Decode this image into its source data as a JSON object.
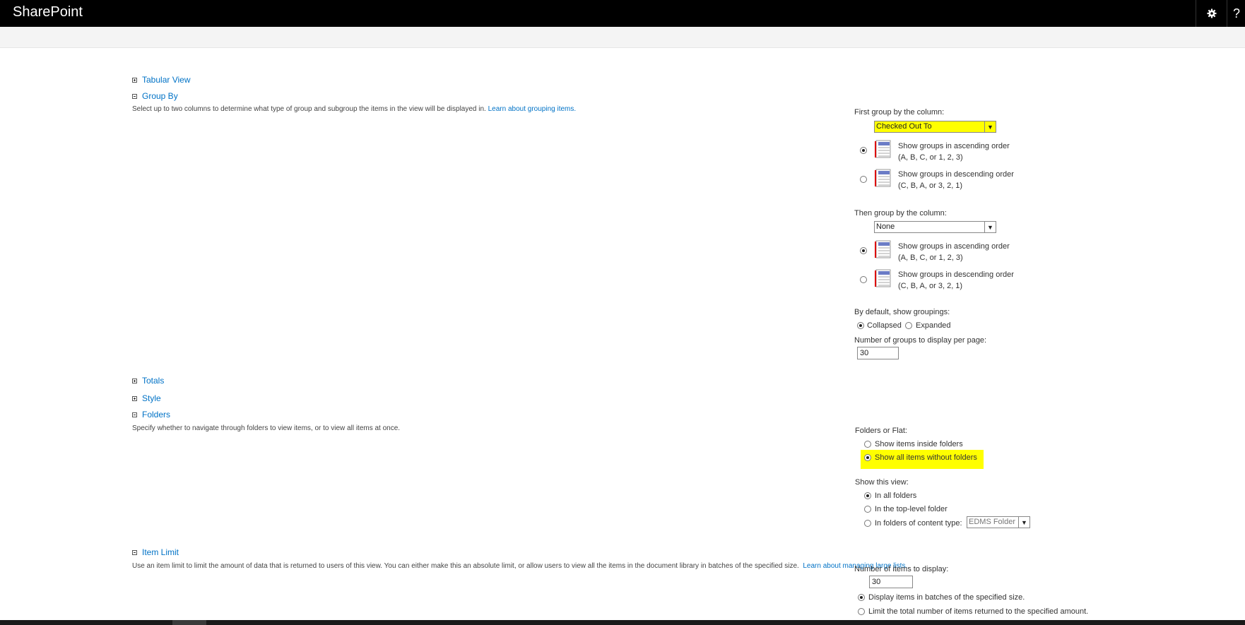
{
  "app": {
    "title": "SharePoint",
    "settings_icon": "gear-icon",
    "help_label": "?"
  },
  "sections": {
    "tabular_view": "Tabular View",
    "group_by": "Group By",
    "group_by_desc": "Select up to two columns to determine what type of group and subgroup the items in the view will be displayed in.",
    "group_by_link": "Learn about grouping items.",
    "totals": "Totals",
    "style": "Style",
    "folders": "Folders",
    "folders_desc": "Specify whether to navigate through folders to view items, or to view all items at once.",
    "item_limit": "Item Limit",
    "item_limit_desc": "Use an item limit to limit the amount of data that is returned to users of this view. You can either make this an absolute limit, or allow users to view all the items in the document library in batches of the specified size.",
    "item_limit_link": "Learn about managing large lists."
  },
  "group": {
    "first_label": "First group by the column:",
    "first_value": "Checked Out To",
    "asc_line1": "Show groups in ascending order",
    "asc_line2": "(A, B, C, or 1, 2, 3)",
    "desc_line1": "Show groups in descending order",
    "desc_line2": "(C, B, A, or 3, 2, 1)",
    "then_label": "Then group by the column:",
    "then_value": "None",
    "default_label": "By default, show groupings:",
    "collapsed": "Collapsed",
    "expanded": "Expanded",
    "per_page_label": "Number of groups to display per page:",
    "per_page_value": "30"
  },
  "folders": {
    "mode_label": "Folders or Flat:",
    "inside": "Show items inside folders",
    "without": "Show all items without folders",
    "show_label": "Show this view:",
    "all_folders": "In all folders",
    "top_level": "In the top-level folder",
    "content_type": "In folders of content type:",
    "content_type_value": "EDMS Folder"
  },
  "limit": {
    "num_label": "Number of items to display:",
    "num_value": "30",
    "batches": "Display items in batches of the specified size.",
    "limit_total": "Limit the total number of items returned to the specified amount."
  }
}
